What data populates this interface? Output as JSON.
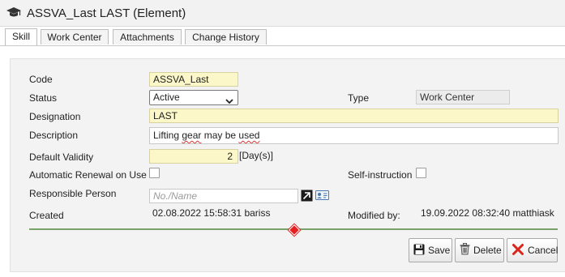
{
  "window": {
    "title": "ASSVA_Last LAST (Element)"
  },
  "tabs": [
    {
      "label": "Skill",
      "active": true
    },
    {
      "label": "Work Center",
      "active": false
    },
    {
      "label": "Attachments",
      "active": false
    },
    {
      "label": "Change History",
      "active": false
    }
  ],
  "form": {
    "code": {
      "label": "Code",
      "value": "ASSVA_Last"
    },
    "status": {
      "label": "Status",
      "value": "Active"
    },
    "type": {
      "label": "Type",
      "value": "Work Center"
    },
    "designation": {
      "label": "Designation",
      "value": "LAST"
    },
    "description": {
      "label": "Description",
      "value_pre": "Lifting ",
      "value_word1": "gear",
      "value_mid": " may be ",
      "value_word2": "used"
    },
    "default_validity": {
      "label": "Default Validity",
      "value": "2",
      "unit": "[Day(s)]"
    },
    "automatic_renewal": {
      "label": "Automatic Renewal on Use",
      "checked": false
    },
    "self_instruction": {
      "label": "Self-instruction",
      "checked": false
    },
    "responsible_person": {
      "label": "Responsible Person",
      "placeholder": "No./Name"
    },
    "created": {
      "label": "Created",
      "value": "02.08.2022 15:58:31 bariss"
    },
    "modified": {
      "label": "Modified by:",
      "value": "19.09.2022 08:32:40 matthiask"
    }
  },
  "buttons": {
    "save": "Save",
    "delete": "Delete",
    "cancel": "Cancel"
  },
  "colors": {
    "required_field": "#fbf7c9",
    "divider": "#7aa36a",
    "marker": "#e52020",
    "cancel_x": "#d9261c"
  }
}
